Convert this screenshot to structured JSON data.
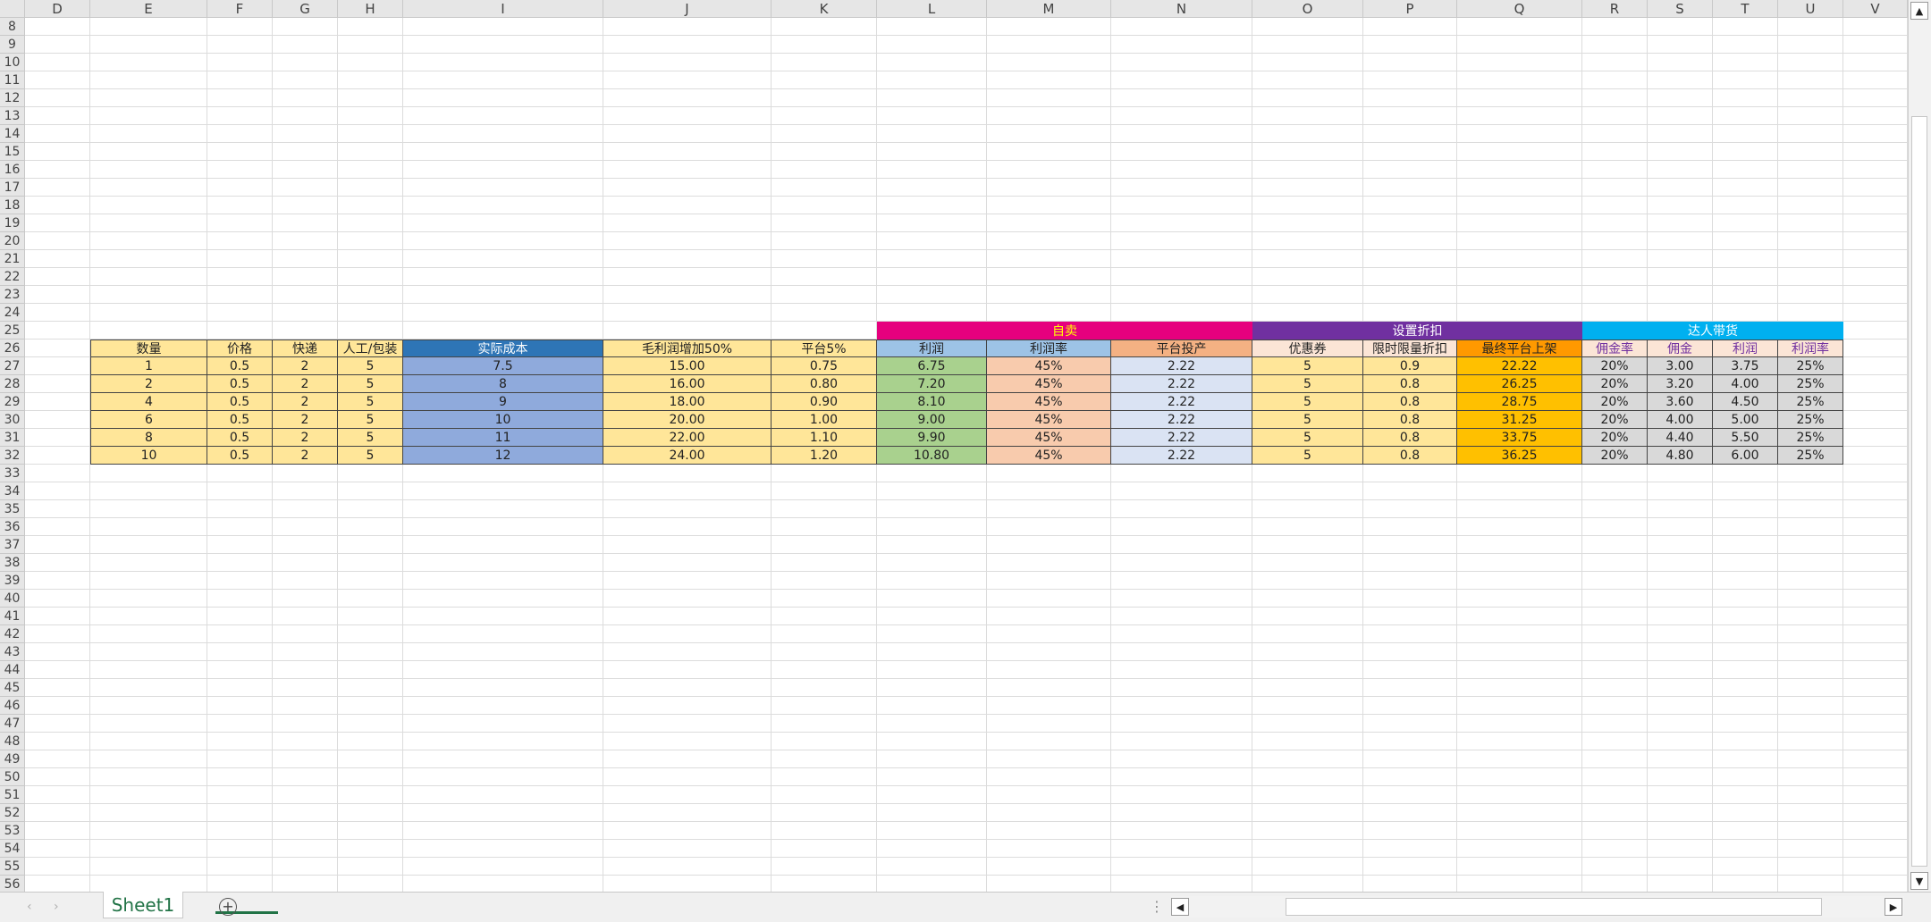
{
  "columns": [
    {
      "label": "D"
    },
    {
      "label": "E"
    },
    {
      "label": "F"
    },
    {
      "label": "G"
    },
    {
      "label": "H"
    },
    {
      "label": "I"
    },
    {
      "label": "J"
    },
    {
      "label": "K"
    },
    {
      "label": "L"
    },
    {
      "label": "M"
    },
    {
      "label": "N"
    },
    {
      "label": "O"
    },
    {
      "label": "P"
    },
    {
      "label": "Q"
    },
    {
      "label": "R"
    },
    {
      "label": "S"
    },
    {
      "label": "T"
    },
    {
      "label": "U"
    },
    {
      "label": "V"
    }
  ],
  "row_start": 8,
  "row_end": 56,
  "groups": [
    {
      "label": "自卖",
      "bg": "#e6007e",
      "fg": "#ffff00"
    },
    {
      "label": "设置折扣",
      "bg": "#7030a0",
      "fg": "#ffffff"
    },
    {
      "label": "达人带货",
      "bg": "#00b0f0",
      "fg": "#ffffff"
    }
  ],
  "headers": [
    {
      "label": "数量",
      "bg": "#ffe699",
      "fg": "#222222"
    },
    {
      "label": "价格",
      "bg": "#ffe699",
      "fg": "#222222"
    },
    {
      "label": "快递",
      "bg": "#ffe699",
      "fg": "#222222"
    },
    {
      "label": "人工/包装",
      "bg": "#ffe699",
      "fg": "#222222"
    },
    {
      "label": "实际成本",
      "bg": "#2e75b6",
      "fg": "#ffffff"
    },
    {
      "label": "毛利润增加50%",
      "bg": "#ffe699",
      "fg": "#222222"
    },
    {
      "label": "平台5%",
      "bg": "#ffe699",
      "fg": "#222222"
    },
    {
      "label": "利润",
      "bg": "#9dc3e6",
      "fg": "#222222"
    },
    {
      "label": "利润率",
      "bg": "#9dc3e6",
      "fg": "#222222"
    },
    {
      "label": "平台投产",
      "bg": "#f4b183",
      "fg": "#222222"
    },
    {
      "label": "优惠券",
      "bg": "#fbe5d6",
      "fg": "#222222"
    },
    {
      "label": "限时限量折扣",
      "bg": "#fbe5d6",
      "fg": "#222222"
    },
    {
      "label": "最终平台上架",
      "bg": "#ff9900",
      "fg": "#222222"
    },
    {
      "label": "佣金率",
      "bg": "#fbe5d6",
      "fg": "#7030a0"
    },
    {
      "label": "佣金",
      "bg": "#fbe5d6",
      "fg": "#7030a0"
    },
    {
      "label": "利润",
      "bg": "#fbe5d6",
      "fg": "#7030a0"
    },
    {
      "label": "利润率",
      "bg": "#fbe5d6",
      "fg": "#7030a0"
    }
  ],
  "column_fills": [
    "#ffe699",
    "#ffe699",
    "#ffe699",
    "#ffe699",
    "#8faadc",
    "#ffe699",
    "#ffe699",
    "#a9d18e",
    "#f8cbad",
    "#dae3f3",
    "#ffe699",
    "#ffe699",
    "#ffc000",
    "#d9d9d9",
    "#d9d9d9",
    "#d9d9d9",
    "#d9d9d9"
  ],
  "rows": [
    [
      "1",
      "0.5",
      "2",
      "5",
      "7.5",
      "15.00",
      "0.75",
      "6.75",
      "45%",
      "2.22",
      "5",
      "0.9",
      "22.22",
      "20%",
      "3.00",
      "3.75",
      "25%"
    ],
    [
      "2",
      "0.5",
      "2",
      "5",
      "8",
      "16.00",
      "0.80",
      "7.20",
      "45%",
      "2.22",
      "5",
      "0.8",
      "26.25",
      "20%",
      "3.20",
      "4.00",
      "25%"
    ],
    [
      "4",
      "0.5",
      "2",
      "5",
      "9",
      "18.00",
      "0.90",
      "8.10",
      "45%",
      "2.22",
      "5",
      "0.8",
      "28.75",
      "20%",
      "3.60",
      "4.50",
      "25%"
    ],
    [
      "6",
      "0.5",
      "2",
      "5",
      "10",
      "20.00",
      "1.00",
      "9.00",
      "45%",
      "2.22",
      "5",
      "0.8",
      "31.25",
      "20%",
      "4.00",
      "5.00",
      "25%"
    ],
    [
      "8",
      "0.5",
      "2",
      "5",
      "11",
      "22.00",
      "1.10",
      "9.90",
      "45%",
      "2.22",
      "5",
      "0.8",
      "33.75",
      "20%",
      "4.40",
      "5.50",
      "25%"
    ],
    [
      "10",
      "0.5",
      "2",
      "5",
      "12",
      "24.00",
      "1.20",
      "10.80",
      "45%",
      "2.22",
      "5",
      "0.8",
      "36.25",
      "20%",
      "4.80",
      "6.00",
      "25%"
    ]
  ],
  "tabs": [
    {
      "label": "Sheet1",
      "active": true
    }
  ],
  "icons": {
    "add_sheet": "plus-circle-icon",
    "scroll_up": "triangle-up-icon",
    "scroll_down": "triangle-down-icon",
    "scroll_left": "triangle-left-icon",
    "scroll_right": "triangle-right-icon",
    "prev": "chevron-left-icon",
    "next": "chevron-right-icon",
    "more": "vertical-dots-icon"
  },
  "glyphs": {
    "add": "+",
    "up": "▲",
    "down": "▼",
    "left": "◀",
    "right": "▶",
    "prev": "‹",
    "next": "›",
    "dots": "⋮"
  }
}
